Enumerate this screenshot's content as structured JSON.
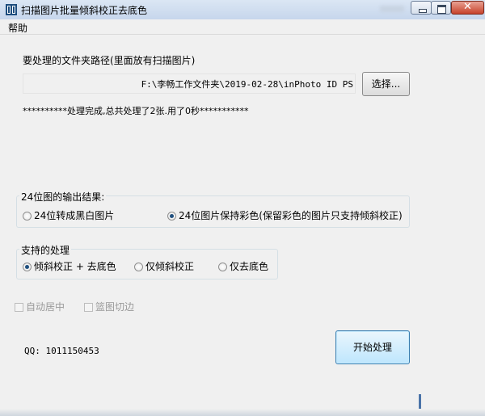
{
  "window": {
    "title": "扫描图片批量倾斜校正去底色",
    "app_icon": "app-icon",
    "accent": "#1d4d7e",
    "close_color": "#c7422b",
    "close_glyph": "✕"
  },
  "menu": {
    "items": [
      {
        "label": "帮助"
      }
    ]
  },
  "folder": {
    "label": "要处理的文件夹路径(里面放有扫描图片)",
    "path": "F:\\李畅工作文件夹\\2019-02-28\\inPhoto ID PS",
    "choose_button": "选择..."
  },
  "status": {
    "message": "**********处理完成,总共处理了2张.用了0秒***********"
  },
  "output_group": {
    "title": "24位图的输出结果:",
    "options": [
      {
        "label": "24位转成黑白图片",
        "checked": false
      },
      {
        "label": "24位图片保持彩色(保留彩色的图片只支持倾斜校正)",
        "checked": true
      }
    ]
  },
  "process_group": {
    "title": "支持的处理",
    "options": [
      {
        "label": "倾斜校正 + 去底色",
        "checked": true
      },
      {
        "label": "仅倾斜校正",
        "checked": false
      },
      {
        "label": "仅去底色",
        "checked": false
      }
    ]
  },
  "checkboxes": [
    {
      "label": "自动居中",
      "checked": false,
      "enabled": false
    },
    {
      "label": "篮图切边",
      "checked": false,
      "enabled": false
    }
  ],
  "contact": {
    "qq": "QQ: 1011150453"
  },
  "start_button": "开始处理"
}
